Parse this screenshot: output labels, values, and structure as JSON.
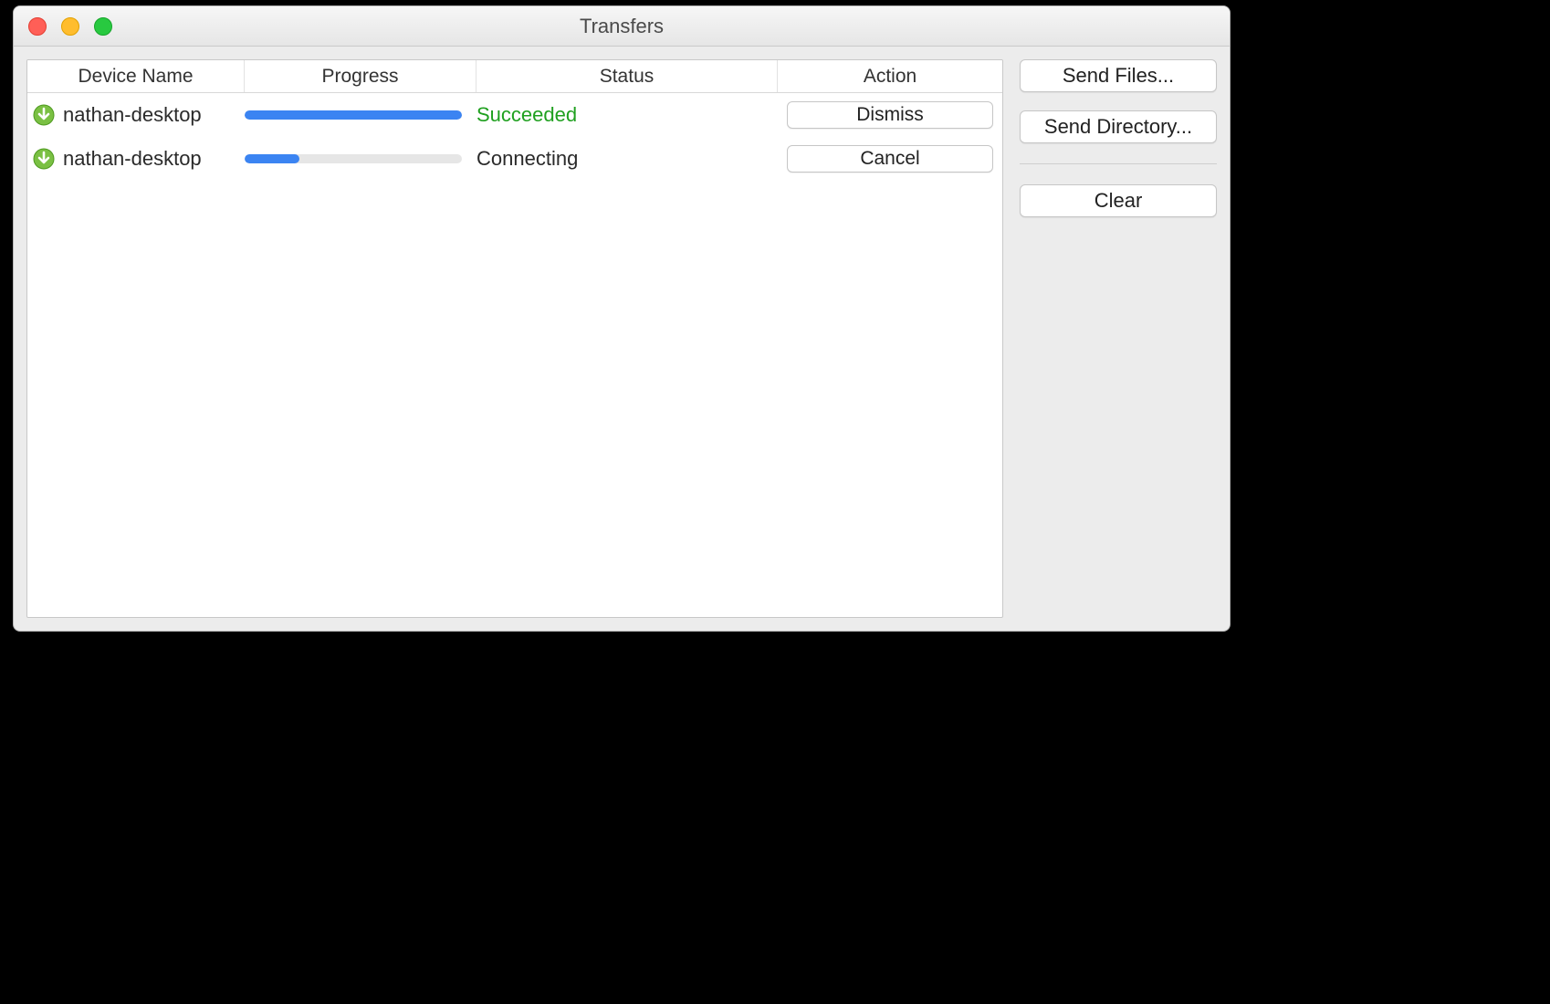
{
  "window": {
    "title": "Transfers"
  },
  "columns": {
    "device": "Device Name",
    "progress": "Progress",
    "status": "Status",
    "action": "Action"
  },
  "rows": [
    {
      "device": "nathan-desktop",
      "progress_pct": 100,
      "status": "Succeeded",
      "status_kind": "succeeded",
      "action_label": "Dismiss"
    },
    {
      "device": "nathan-desktop",
      "progress_pct": 25,
      "status": "Connecting",
      "status_kind": "connecting",
      "action_label": "Cancel"
    }
  ],
  "sidebar": {
    "send_files": "Send Files...",
    "send_directory": "Send Directory...",
    "clear": "Clear"
  },
  "colors": {
    "progress_fill": "#3b84f2",
    "status_success": "#1fa01f"
  }
}
